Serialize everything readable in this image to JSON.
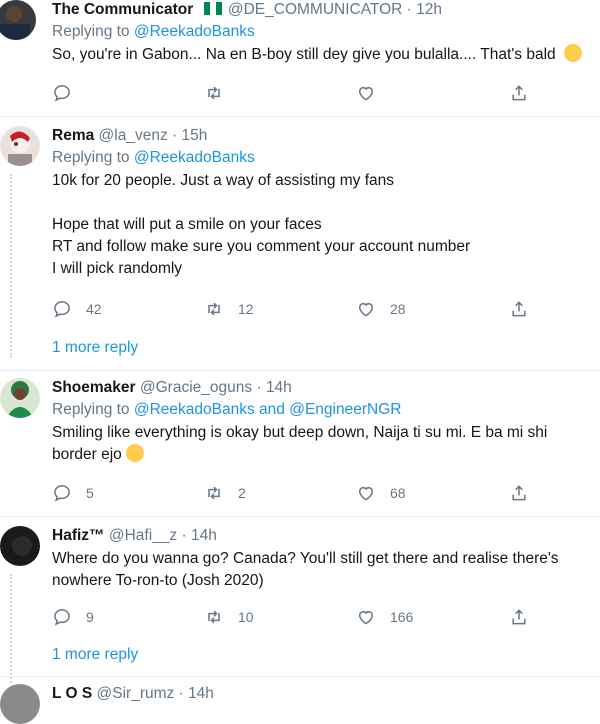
{
  "tweets": [
    {
      "name": "The Communicator",
      "handle": "@DE_COMMUNICATOR",
      "time": "12h",
      "replying_prefix": "Replying to",
      "replying_to": "@ReekadoBanks",
      "text": [
        "So, you're in Gabon... Na en B-boy still dey give you bulalla.... That's bald"
      ],
      "counts": {
        "reply": "",
        "retweet": "",
        "like": ""
      }
    },
    {
      "name": "Rema",
      "handle": "@la_venz",
      "time": "15h",
      "replying_prefix": "Replying to",
      "replying_to": "@ReekadoBanks",
      "text": [
        "10k for 20 people. Just a way of assisting my fans",
        "",
        "Hope that will put a smile on your faces",
        "RT and follow make sure you comment your account number",
        "I will pick randomly"
      ],
      "counts": {
        "reply": "42",
        "retweet": "12",
        "like": "28"
      }
    },
    {
      "name": "Shoemaker",
      "handle": "@Gracie_oguns",
      "time": "14h",
      "replying_prefix": "Replying to",
      "replying_to": "@ReekadoBanks",
      "replying_and": "and",
      "replying_to_2": "@EngineerNGR",
      "text": [
        "Smiling like everything is okay but deep down, Naija ti su mi. E ba mi shi",
        "border ejo"
      ],
      "counts": {
        "reply": "5",
        "retweet": "2",
        "like": "68"
      }
    },
    {
      "name": "Hafiz™",
      "handle": "@Hafi__z",
      "time": "14h",
      "text": [
        "Where do you wanna go? Canada? You'll still get there and realise there's",
        "nowhere To-ron-to (Josh 2020)"
      ],
      "counts": {
        "reply": "9",
        "retweet": "10",
        "like": "166"
      }
    },
    {
      "name": "L O S",
      "handle": "@Sir_rumz",
      "time": "14h"
    }
  ],
  "more_reply": "1 more reply",
  "separator": "·",
  "colors": {
    "link": "#1b95e0",
    "meta": "#657786",
    "divider": "#e6ecf0"
  },
  "icons": [
    "reply-icon",
    "retweet-icon",
    "like-icon",
    "share-icon"
  ]
}
